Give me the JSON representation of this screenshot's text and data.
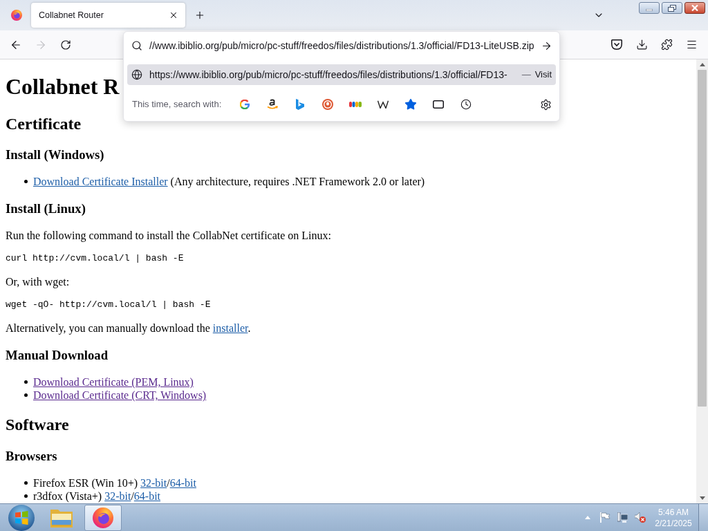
{
  "tabs": [
    {
      "title": "Collabnet Router",
      "selected": true
    }
  ],
  "toolbar": {
    "nav_buttons": [
      {
        "kind": "back",
        "disabled": false
      },
      {
        "kind": "forward",
        "disabled": true
      },
      {
        "kind": "reload",
        "disabled": false
      }
    ]
  },
  "urlbar": {
    "value": "//www.ibiblio.org/pub/micro/pc-stuff/freedos/files/distributions/1.3/official/FD13-LiteUSB.zip",
    "suggestions": [
      {
        "url": "https://www.ibiblio.org/pub/micro/pc-stuff/freedos/files/distributions/1.3/official/FD13-",
        "separator": "—",
        "action": "Visit",
        "selected": true
      }
    ],
    "search_with_label": "This time, search with:"
  },
  "page": {
    "blocks": [
      {
        "kind": "h1",
        "text": "Collabnet R"
      },
      {
        "kind": "h2",
        "text": "Certificate"
      },
      {
        "kind": "h3",
        "text": "Install (Windows)"
      },
      {
        "kind": "list",
        "items": [
          {
            "parts": [
              {
                "kind": "link",
                "text": "Download Certificate Installer",
                "visited": false
              },
              {
                "kind": "text",
                "text": " (Any architecture, requires .NET Framework 2.0 or later)"
              }
            ]
          }
        ]
      },
      {
        "kind": "h3",
        "text": "Install (Linux)"
      },
      {
        "kind": "p",
        "parts": [
          {
            "kind": "text",
            "text": "Run the following command to install the CollabNet certificate on Linux:"
          }
        ]
      },
      {
        "kind": "code",
        "text": "curl http://cvm.local/l | bash -E"
      },
      {
        "kind": "p",
        "parts": [
          {
            "kind": "text",
            "text": "Or, with wget:"
          }
        ]
      },
      {
        "kind": "code",
        "text": "wget -qO- http://cvm.local/l | bash -E"
      },
      {
        "kind": "p",
        "parts": [
          {
            "kind": "text",
            "text": "Alternatively, you can manually download the "
          },
          {
            "kind": "link",
            "text": "installer",
            "visited": false
          },
          {
            "kind": "text",
            "text": "."
          }
        ]
      },
      {
        "kind": "h3",
        "text": "Manual Download"
      },
      {
        "kind": "list",
        "items": [
          {
            "parts": [
              {
                "kind": "link",
                "text": "Download Certificate (PEM, Linux)",
                "visited": true
              }
            ]
          },
          {
            "parts": [
              {
                "kind": "link",
                "text": "Download Certificate (CRT, Windows)",
                "visited": true
              }
            ]
          }
        ]
      },
      {
        "kind": "h2",
        "text": "Software"
      },
      {
        "kind": "h3",
        "text": "Browsers"
      },
      {
        "kind": "list",
        "items": [
          {
            "parts": [
              {
                "kind": "text",
                "text": "Firefox ESR (Win 10+) "
              },
              {
                "kind": "link",
                "text": "32-bit",
                "visited": false
              },
              {
                "kind": "text",
                "text": "/"
              },
              {
                "kind": "link",
                "text": "64-bit",
                "visited": false
              }
            ]
          },
          {
            "parts": [
              {
                "kind": "text",
                "text": "r3dfox (Vista+) "
              },
              {
                "kind": "link",
                "text": "32-bit",
                "visited": false
              },
              {
                "kind": "text",
                "text": "/"
              },
              {
                "kind": "link",
                "text": "64-bit",
                "visited": false
              }
            ]
          }
        ]
      }
    ]
  },
  "taskbar": {
    "apps": [
      {
        "kind": "explorer",
        "selected": false
      },
      {
        "kind": "browser",
        "selected": true
      }
    ],
    "time": "5:46 AM",
    "date": "2/21/2025"
  }
}
